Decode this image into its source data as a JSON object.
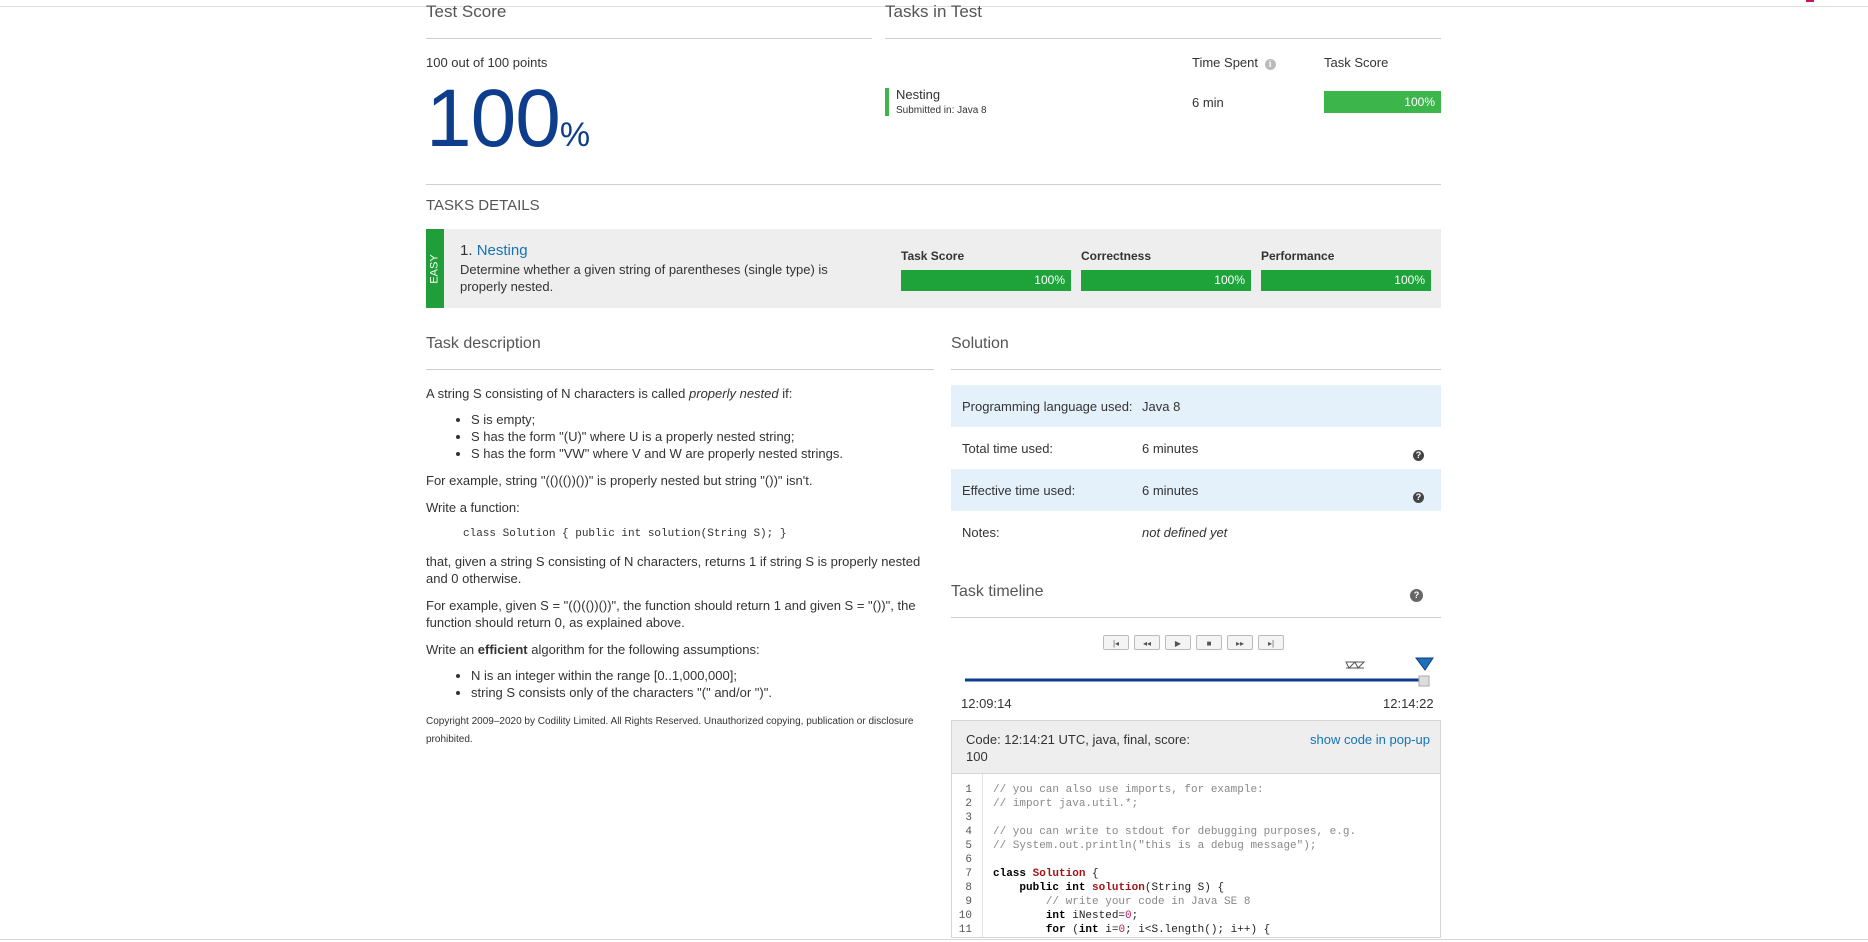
{
  "test_score": {
    "heading": "Test Score",
    "points_text": "100 out of 100 points",
    "percent_value": "100",
    "percent_sign": "%"
  },
  "tasks_in_test": {
    "heading": "Tasks in Test",
    "col_time_spent": "Time Spent",
    "col_task_score": "Task Score",
    "task_name": "Nesting",
    "submitted_in": "Submitted in: Java 8",
    "time_spent": "6 min",
    "score_label": "100%",
    "score_fraction": 1.0
  },
  "tasks_details": {
    "heading": "TASKS DETAILS",
    "difficulty": "EASY",
    "task_number": "1.",
    "task_name": "Nesting",
    "task_summary": "Determine whether a given string of parentheses (single type) is properly nested.",
    "metrics": [
      {
        "label": "Task Score",
        "value": "100%"
      },
      {
        "label": "Correctness",
        "value": "100%"
      },
      {
        "label": "Performance",
        "value": "100%"
      }
    ]
  },
  "task_description": {
    "heading": "Task description",
    "intro_a": "A string S consisting of N characters is called ",
    "intro_em": "properly nested",
    "intro_b": " if:",
    "bullets": [
      "S is empty;",
      "S has the form \"(U)\" where U is a properly nested string;",
      "S has the form \"VW\" where V and W are properly nested strings."
    ],
    "example1": "For example, string \"(()(())())\" is properly nested but string \"())\" isn't.",
    "write_function": "Write a function:",
    "signature": "class Solution { public int solution(String S); }",
    "returns": "that, given a string S consisting of N characters, returns 1 if string S is properly nested and 0 otherwise.",
    "example2": "For example, given S = \"(()(())())\", the function should return 1 and given S = \"())\", the function should return 0, as explained above.",
    "efficient_a": "Write an ",
    "efficient_b": "efficient",
    "efficient_c": " algorithm for the following assumptions:",
    "assumptions": [
      "N is an integer within the range [0..1,000,000];",
      "string S consists only of the characters \"(\" and/or \")\"."
    ],
    "copyright": "Copyright 2009–2020 by Codility Limited. All Rights Reserved. Unauthorized copying, publication or disclosure prohibited."
  },
  "solution": {
    "heading": "Solution",
    "rows": [
      {
        "label": "Programming language used:",
        "value": "Java 8"
      },
      {
        "label": "Total time used:",
        "value": "6 minutes"
      },
      {
        "label": "Effective time used:",
        "value": "6 minutes"
      },
      {
        "label": "Notes:",
        "value": "not defined yet"
      }
    ]
  },
  "timeline": {
    "heading": "Task timeline",
    "start_time": "12:09:14",
    "end_time": "12:14:22",
    "buttons": [
      "|◂",
      "◂◂",
      "▶",
      "■",
      "▸▸",
      "▸|"
    ]
  },
  "code": {
    "header": "Code: 12:14:21 UTC, java, final, score:",
    "score": "100",
    "popup_link": "show code in pop-up",
    "line_numbers": [
      "1",
      "2",
      "3",
      "4",
      "5",
      "6",
      "7",
      "8",
      "9",
      "10",
      "11"
    ],
    "lines": [
      "// you can also use imports, for example:",
      "// import java.util.*;",
      "",
      "// you can write to stdout for debugging purposes, e.g.",
      "// System.out.println(\"this is a debug message\");",
      "",
      "class Solution {",
      "    public int solution(String S) {",
      "        // write your code in Java SE 8",
      "        int iNested=0;",
      "        for (int i=0; i<S.length(); i++) {"
    ]
  },
  "colors": {
    "accent_blue": "#0d3d8c",
    "link_blue": "#1573b6",
    "success_green": "#3cb54a",
    "easy_green": "#1f9e3a"
  }
}
